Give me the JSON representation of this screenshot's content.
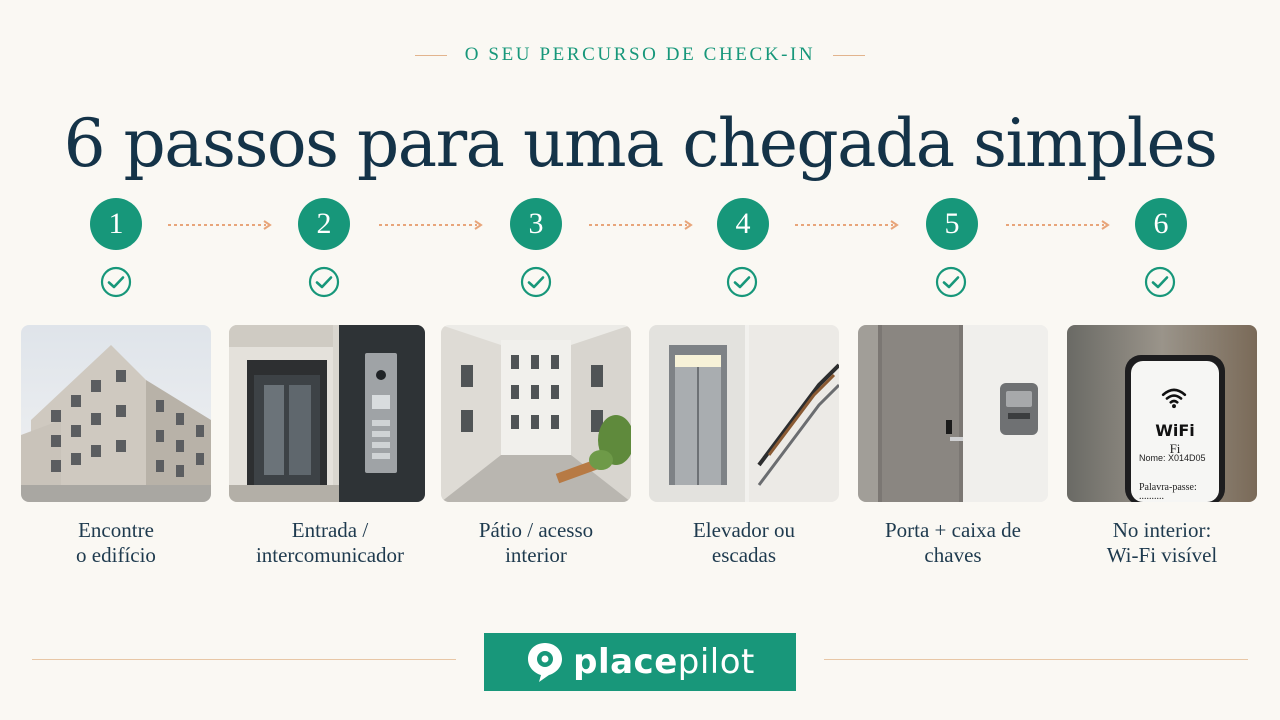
{
  "header": {
    "eyebrow": "O SEU PERCURSO DE CHECK-IN",
    "title": "6 passos para uma chegada simples"
  },
  "steps": [
    {
      "number": "1",
      "line1": "Encontre",
      "line2": "o edifício",
      "icon": "check-circle-icon"
    },
    {
      "number": "2",
      "line1": "Entrada /",
      "line2": "intercomunicador",
      "icon": "check-circle-icon"
    },
    {
      "number": "3",
      "line1": "Pátio / acesso",
      "line2": "interior",
      "icon": "check-circle-icon"
    },
    {
      "number": "4",
      "line1": "Elevador ou",
      "line2": "escadas",
      "icon": "check-circle-icon"
    },
    {
      "number": "5",
      "line1": "Porta + caixa de",
      "line2": "chaves",
      "icon": "check-circle-icon"
    },
    {
      "number": "6",
      "line1": "No interior:",
      "line2": "Wi-Fi visível",
      "icon": "check-circle-icon"
    }
  ],
  "phone": {
    "wifi_label": "WiFi",
    "fi": "Fi",
    "name_label": "Nome:",
    "name_value": "X014D05",
    "password_label": "Palavra-passe:",
    "password_value": ".........."
  },
  "brand": {
    "part1": "place",
    "part2": "pilot"
  },
  "colors": {
    "accent": "#17977a",
    "title": "#143348",
    "arrow": "#e8a57a",
    "background": "#faf8f3"
  }
}
